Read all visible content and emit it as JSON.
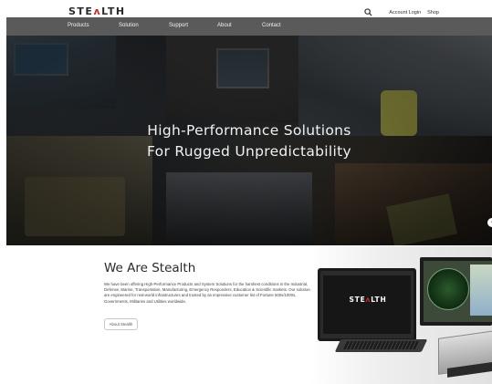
{
  "header": {
    "logo_pre": "STE",
    "logo_a": "ʌ",
    "logo_post": "LTH",
    "search_icon": "search-icon",
    "account_login": "Account Login",
    "shop": "Shop"
  },
  "nav": {
    "items": [
      "Products",
      "Solution",
      "Support",
      "About",
      "Contact"
    ]
  },
  "hero": {
    "line1": "High-Performance Solutions",
    "line2": "For Rugged Unpredictability",
    "next_arrow": "‹"
  },
  "about": {
    "title": "We Are Stealth",
    "text": "We have been offering High-Performance Products and System Solutions for the harshest conditions in the Industrial, Defense, Marine, Transportation, Manufacturing, Emergency Responders, Education & Scientific markets. Our solutions are engineered for real-world infrastructures and trusted by an impressive customer list of Fortune 500s/1000s, Governments, Militaries and Utilities worldwide.",
    "button": "About Stealth"
  },
  "product": {
    "logo_pre": "STE",
    "logo_a": "ʌ",
    "logo_post": "LTH"
  },
  "colors": {
    "accent": "#d0271d",
    "navbar": "#5a5a5a"
  }
}
